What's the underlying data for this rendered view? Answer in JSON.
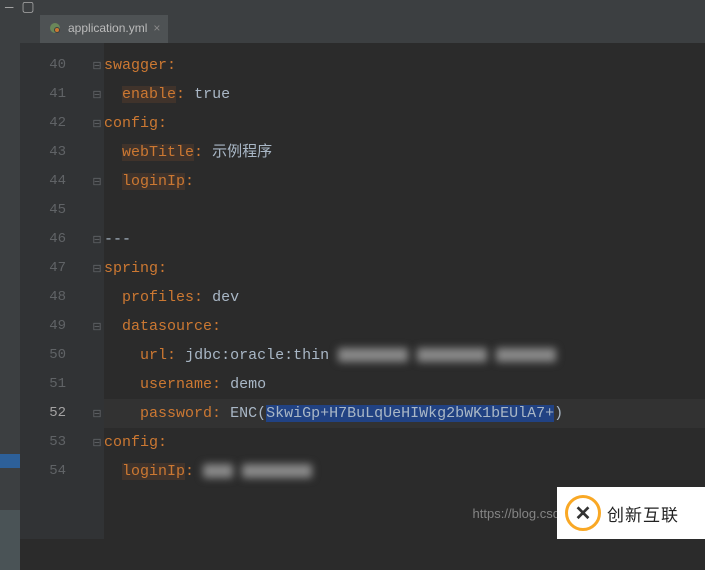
{
  "tab": {
    "filename": "application.yml"
  },
  "gutter": {
    "start": 40,
    "end": 54
  },
  "code": {
    "l40": {
      "key": "swagger"
    },
    "l41": {
      "key": "enable",
      "val": "true"
    },
    "l42": {
      "key": "config"
    },
    "l43": {
      "key": "webTitle",
      "val": "示例程序"
    },
    "l44": {
      "key": "loginIp"
    },
    "l45": {},
    "l46": {
      "dashes": "---"
    },
    "l47": {
      "key": "spring"
    },
    "l48": {
      "key": "profiles",
      "val": "dev"
    },
    "l49": {
      "key": "datasource"
    },
    "l50": {
      "key": "url",
      "val": "jdbc:oracle:thin"
    },
    "l51": {
      "key": "username",
      "val": "demo"
    },
    "l52": {
      "key": "password",
      "enc_prefix": "ENC(",
      "enc_val": "SkwiGp+H7BuLqUeHIWkg2bWK1bEUlA7+",
      "enc_suffix": ")"
    },
    "l53": {
      "key": "config"
    },
    "l54": {
      "key": "loginIp"
    }
  },
  "watermark": "https://blog.csd",
  "brand": "创新互联"
}
